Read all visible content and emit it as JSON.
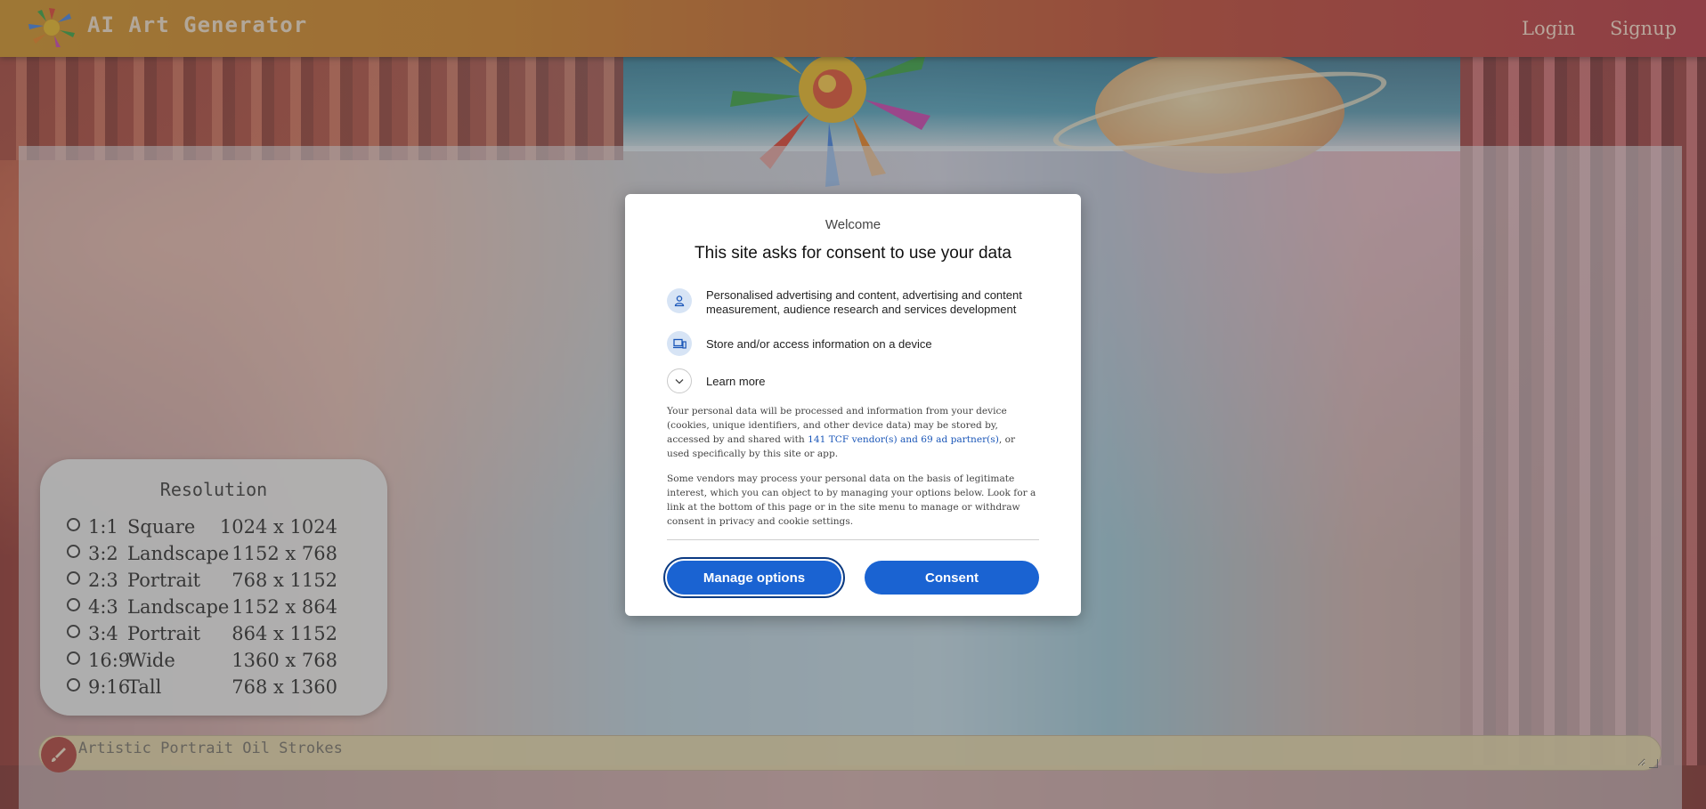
{
  "header": {
    "title": "AI Art Generator",
    "nav": {
      "login": "Login",
      "signup": "Signup"
    }
  },
  "resolution": {
    "title": "Resolution",
    "options": [
      {
        "ratio": "1:1",
        "name": "Square",
        "dims": "1024 x 1024",
        "selected": false
      },
      {
        "ratio": "3:2",
        "name": "Landscape",
        "dims": "1152 x 768",
        "selected": false
      },
      {
        "ratio": "2:3",
        "name": "Portrait",
        "dims": "768 x 1152",
        "selected": false
      },
      {
        "ratio": "4:3",
        "name": "Landscape",
        "dims": "1152 x 864",
        "selected": false
      },
      {
        "ratio": "3:4",
        "name": "Portrait",
        "dims": "864 x 1152",
        "selected": false
      },
      {
        "ratio": "16:9",
        "name": "Wide",
        "dims": "1360 x 768",
        "selected": false
      },
      {
        "ratio": "9:16",
        "name": "Tall",
        "dims": "768 x 1360",
        "selected": false
      }
    ]
  },
  "prompt": {
    "placeholder": "Artistic Portrait Oil Strokes",
    "icon": "brush-icon"
  },
  "consent_dialog": {
    "welcome": "Welcome",
    "heading": "This site asks for consent to use your data",
    "items": [
      {
        "icon": "person-icon",
        "text": "Personalised advertising and content, advertising and content measurement, audience research and services development"
      },
      {
        "icon": "devices-icon",
        "text": "Store and/or access information on a device"
      }
    ],
    "learn_more": "Learn more",
    "para1_before": "Your personal data will be processed and information from your device (cookies, unique identifiers, and other device data) may be stored by, accessed by and shared with ",
    "para1_link": "141 TCF vendor(s) and 69 ad partner(s)",
    "para1_after": ", or used specifically by this site or app.",
    "para2": "Some vendors may process your personal data on the basis of legitimate interest, which you can object to by managing your options below. Look for a link at the bottom of this page or in the site menu to manage or withdraw consent in privacy and cookie settings.",
    "buttons": {
      "manage": "Manage options",
      "consent": "Consent"
    }
  },
  "colors": {
    "primary_button": "#1a63d2",
    "header_start": "#c98a1f",
    "header_end": "#b02f3a",
    "link": "#1a56b8"
  }
}
